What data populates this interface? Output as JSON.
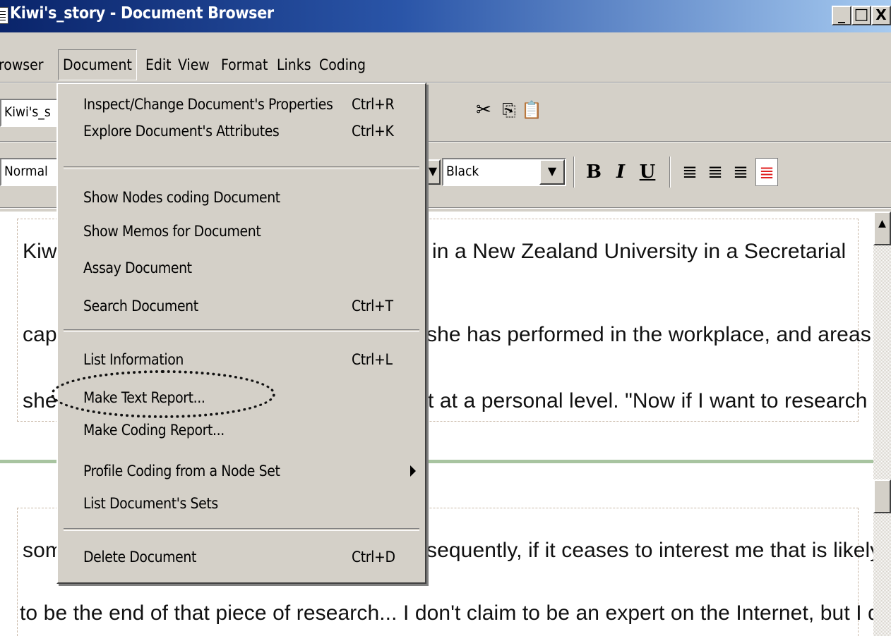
{
  "window": {
    "title": "Kiwi's_story - Document Browser",
    "minimize": "_",
    "maximize": "□",
    "close": "X"
  },
  "menubar": {
    "items": [
      "rowser",
      "Document",
      "Edit",
      "View",
      "Format",
      "Links",
      "Coding"
    ]
  },
  "toolbar": {
    "document_combo": "Kiwi's_s",
    "style_combo": "Normal",
    "color_combo": "Black",
    "bold": "B",
    "italic": "I",
    "underline": "U",
    "icons": [
      "cut-icon",
      "copy-icon",
      "paste-icon",
      "align-left-icon",
      "align-center-icon",
      "align-right-icon",
      "justify-icon"
    ]
  },
  "document_menu": {
    "items": [
      {
        "label": "Inspect/Change Document's Properties",
        "shortcut": "Ctrl+R"
      },
      {
        "label": "Explore Document's Attributes",
        "shortcut": "Ctrl+K"
      },
      {
        "label": "Show Nodes coding Document",
        "shortcut": ""
      },
      {
        "label": "Show Memos for Document",
        "shortcut": ""
      },
      {
        "label": "Assay Document",
        "shortcut": ""
      },
      {
        "label": "Search Document",
        "shortcut": "Ctrl+T"
      },
      {
        "label": "List Information",
        "shortcut": "Ctrl+L"
      },
      {
        "label": "Make Text Report...",
        "shortcut": ""
      },
      {
        "label": "Make Coding Report...",
        "shortcut": ""
      },
      {
        "label": "Profile Coding from a Node Set",
        "shortcut": ""
      },
      {
        "label": "List Document's Sets",
        "shortcut": ""
      },
      {
        "label": "Delete Document",
        "shortcut": "Ctrl+D"
      }
    ]
  },
  "document_text": {
    "lines_left": [
      "Kiwi",
      "capa",
      "she",
      "som"
    ],
    "lines_right": [
      "in a New Zealand University in a Secretarial",
      "she has performed in the workplace, and areas",
      "t at a personal level. \"Now if I want to research",
      "sequently, if it ceases to interest me that is likely"
    ],
    "full_line": "to be the end of that piece of research... I don't claim to be an expert on the Internet, but I do"
  },
  "colors": {
    "title_start": "#0a246a",
    "title_end": "#a6caf0",
    "justify_active": "#e02020",
    "divider": "#a8c4a0"
  }
}
